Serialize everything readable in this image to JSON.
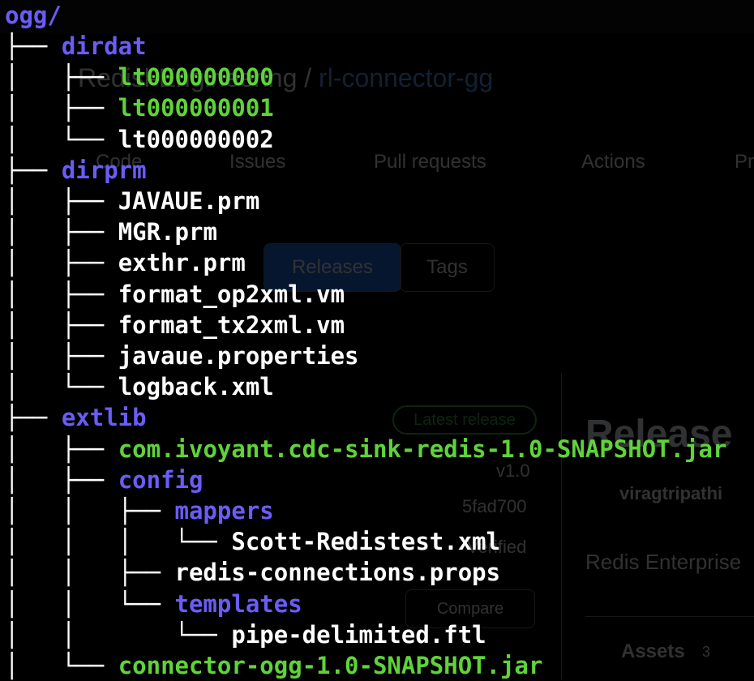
{
  "background_page": {
    "repo_owner_partial": "Redis",
    "repo_owner_suffix": "l-Engineering",
    "repo_separator": "/",
    "repo_name": "rl-connector-gg",
    "tabs": [
      "Code",
      "Issues",
      "Pull requests",
      "Actions",
      "Pr"
    ],
    "release_toggle": [
      "Releases",
      "Tags"
    ],
    "latest_release": "Latest release",
    "release_heading": "Release",
    "tag": "v1.0",
    "commit": "5fad700",
    "verified": "Verified",
    "author": "viragtripathi",
    "description": "Redis Enterprise",
    "compare": "Compare",
    "assets_label": "Assets",
    "assets_count": "3"
  },
  "tree": {
    "root": "ogg/",
    "rows": [
      {
        "prefix": "├── ",
        "name": "dirdat",
        "kind": "dir"
      },
      {
        "prefix": "│   ├── ",
        "name": "lt000000000",
        "kind": "green"
      },
      {
        "prefix": "│   ├── ",
        "name": "lt000000001",
        "kind": "green"
      },
      {
        "prefix": "│   └── ",
        "name": "lt000000002",
        "kind": "plain"
      },
      {
        "prefix": "├── ",
        "name": "dirprm",
        "kind": "dir"
      },
      {
        "prefix": "│   ├── ",
        "name": "JAVAUE.prm",
        "kind": "plain"
      },
      {
        "prefix": "│   ├── ",
        "name": "MGR.prm",
        "kind": "plain"
      },
      {
        "prefix": "│   ├── ",
        "name": "exthr.prm",
        "kind": "plain"
      },
      {
        "prefix": "│   ├── ",
        "name": "format_op2xml.vm",
        "kind": "plain"
      },
      {
        "prefix": "│   ├── ",
        "name": "format_tx2xml.vm",
        "kind": "plain"
      },
      {
        "prefix": "│   ├── ",
        "name": "javaue.properties",
        "kind": "plain"
      },
      {
        "prefix": "│   └── ",
        "name": "logback.xml",
        "kind": "plain"
      },
      {
        "prefix": "├── ",
        "name": "extlib",
        "kind": "dir"
      },
      {
        "prefix": "│   ├── ",
        "name": "com.ivoyant.cdc-sink-redis-1.0-SNAPSHOT.jar",
        "kind": "green"
      },
      {
        "prefix": "│   ├── ",
        "name": "config",
        "kind": "dir"
      },
      {
        "prefix": "│   │   ├── ",
        "name": "mappers",
        "kind": "dir"
      },
      {
        "prefix": "│   │   │   └── ",
        "name": "Scott-Redistest.xml",
        "kind": "plain"
      },
      {
        "prefix": "│   │   ├── ",
        "name": "redis-connections.props",
        "kind": "plain"
      },
      {
        "prefix": "│   │   └── ",
        "name": "templates",
        "kind": "dir"
      },
      {
        "prefix": "│   │       └── ",
        "name": "pipe-delimited.ftl",
        "kind": "plain"
      },
      {
        "prefix": "│   └── ",
        "name": "connector-ogg-1.0-SNAPSHOT.jar",
        "kind": "green"
      }
    ]
  },
  "colors": {
    "terminal_bg": "#000000",
    "directory": "#6b5cf6",
    "executable": "#5fd33a",
    "file": "#ffffff"
  }
}
